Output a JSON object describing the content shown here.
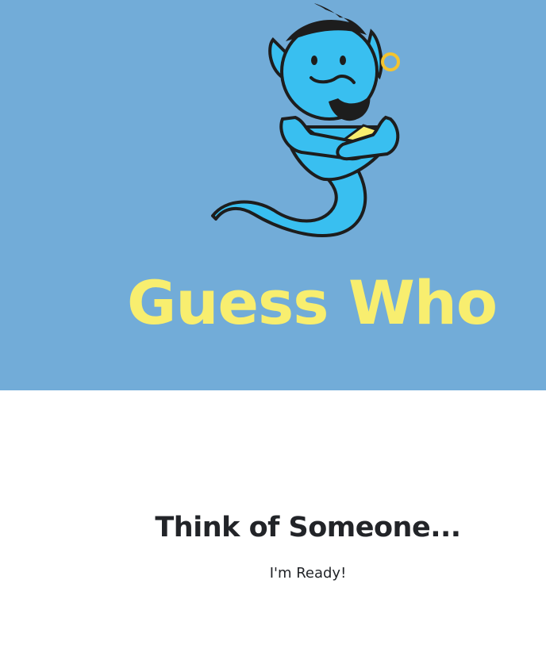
{
  "hero": {
    "title": "Guess Who",
    "mascot_icon": "genie-icon",
    "background_color": "#72acd8",
    "title_color": "#f8ee6f"
  },
  "main": {
    "heading": "Think of Someone...",
    "ready_button_label": "I'm Ready!",
    "text_color": "#222428"
  }
}
